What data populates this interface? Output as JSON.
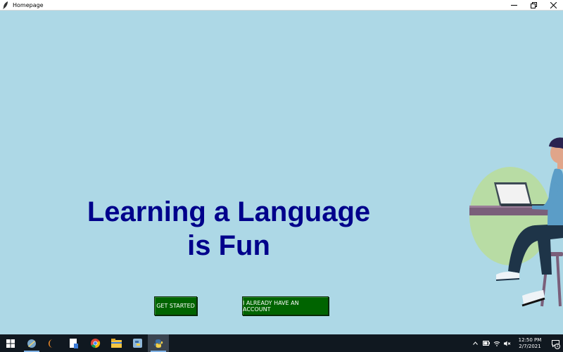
{
  "window": {
    "title": "Homepage",
    "icon": "feather-icon",
    "controls": [
      "minimize-icon",
      "restore-icon",
      "close-icon"
    ]
  },
  "main": {
    "headline_line1": "Learning a Language",
    "headline_line2": "is Fun",
    "get_started_label": "GET STARTED",
    "account_label": "I ALREADY HAVE AN ACCOUNT"
  },
  "colors": {
    "background": "#add8e6",
    "headline": "#00008b",
    "button_bg": "#006400",
    "button_text": "#ffffff",
    "taskbar": "#101820"
  },
  "taskbar": {
    "apps": [
      "start-icon",
      "app-icon",
      "eclipse-icon",
      "notepad-icon",
      "chrome-icon",
      "file-explorer-icon",
      "python-idle-icon",
      "python-icon"
    ],
    "clock_time": "12:50 PM",
    "clock_date": "2/7/2021",
    "notification_count": "1"
  }
}
